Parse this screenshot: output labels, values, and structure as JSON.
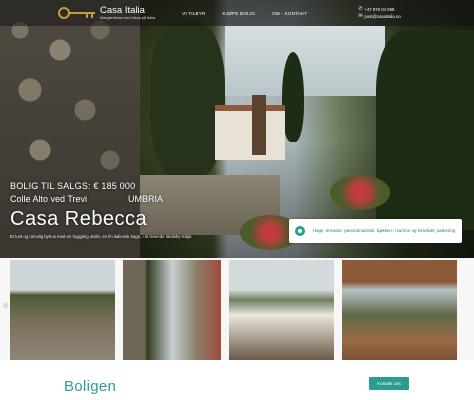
{
  "header": {
    "brand_name": "Casa Italia",
    "brand_tagline": "Maeglerfirma med fokus på Italia",
    "nav": [
      "VI TILBYR",
      "KJØPE BOLIG",
      "OM - KONTAKT"
    ],
    "phone": "+47 976 04 068",
    "email": "post@casaitalia.no"
  },
  "hero": {
    "price": "BOLIG TIL SALGS: € 185 000",
    "location": "Colle Alto ved Trevi",
    "region": "UMBRIA",
    "title": "Casa Rebecca",
    "description": "Et lunt og romslig byhus med en hyggelig utsikt, en fin italiensk hage, i et levende landsby-miljø."
  },
  "features_badge": {
    "text": "Hage, terrasse, panoramautsikt, kjøkken i marmor og kirsebær, parkering"
  },
  "gallery": {
    "items": [
      "image-1",
      "image-2",
      "image-3",
      "image-4"
    ],
    "prev_icon": "chevron-left-icon"
  },
  "section": {
    "title": "Boligen",
    "contact_button": "Kontakt oss"
  },
  "colors": {
    "accent": "#2a9d8f",
    "logo_gold": "#c99a3c"
  }
}
